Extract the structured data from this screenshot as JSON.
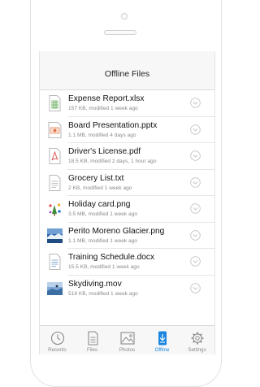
{
  "screen": {
    "title": "Offline Files"
  },
  "files": [
    {
      "name": "Expense Report.xlsx",
      "meta": "157 KB, modified 1 week ago",
      "icon": "spreadsheet-icon"
    },
    {
      "name": "Board Presentation.pptx",
      "meta": "1.1 MB, modified 4 days ago",
      "icon": "presentation-icon"
    },
    {
      "name": "Driver's License.pdf",
      "meta": "18.5 KB, modified 2 days, 1 hour ago",
      "icon": "pdf-icon"
    },
    {
      "name": "Grocery List.txt",
      "meta": "2 KB, modified 1 week ago",
      "icon": "text-file-icon"
    },
    {
      "name": "Holiday card.png",
      "meta": "3.5 MB, modified 1 week ago",
      "icon": "image-thumb-icon"
    },
    {
      "name": "Perito Moreno Glacier.png",
      "meta": "1.1 MB, modified 1 week ago",
      "icon": "photo-thumb-icon"
    },
    {
      "name": "Training Schedule.docx",
      "meta": "15.5 KB, modified 1 week ago",
      "icon": "document-icon"
    },
    {
      "name": "Skydiving.mov",
      "meta": "518 KB, modified 1 week ago",
      "icon": "video-thumb-icon"
    }
  ],
  "tabs": [
    {
      "label": "Recents",
      "icon": "clock-icon",
      "active": false
    },
    {
      "label": "Files",
      "icon": "files-icon",
      "active": false
    },
    {
      "label": "Photos",
      "icon": "photos-icon",
      "active": false
    },
    {
      "label": "Offline",
      "icon": "offline-icon",
      "active": true
    },
    {
      "label": "Settings",
      "icon": "gear-icon",
      "active": false
    }
  ],
  "colors": {
    "accent": "#1b86e0"
  }
}
